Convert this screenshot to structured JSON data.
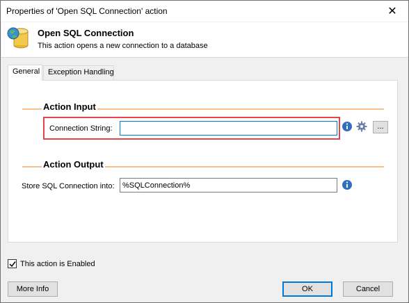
{
  "window": {
    "title": "Properties of 'Open SQL Connection' action",
    "close_glyph": "✕"
  },
  "header": {
    "title": "Open SQL Connection",
    "subtitle": "This action opens a new connection to a database",
    "icon": "database-globe-icon"
  },
  "tabs": [
    {
      "label": "General",
      "active": true
    },
    {
      "label": "Exception Handling",
      "active": false
    }
  ],
  "action_input": {
    "heading": "Action Input",
    "connection_string_label": "Connection String:",
    "connection_string_value": "",
    "ellipsis_label": "..."
  },
  "action_output": {
    "heading": "Action Output",
    "store_label": "Store SQL Connection into:",
    "store_value": "%SQLConnection%"
  },
  "footer": {
    "enabled_label": "This action is Enabled",
    "enabled_checked": true,
    "more_info_label": "More Info",
    "ok_label": "OK",
    "cancel_label": "Cancel"
  },
  "colors": {
    "section_rule": "#f7c08a",
    "highlight": "#e34450",
    "focus_border": "#0078d7"
  }
}
